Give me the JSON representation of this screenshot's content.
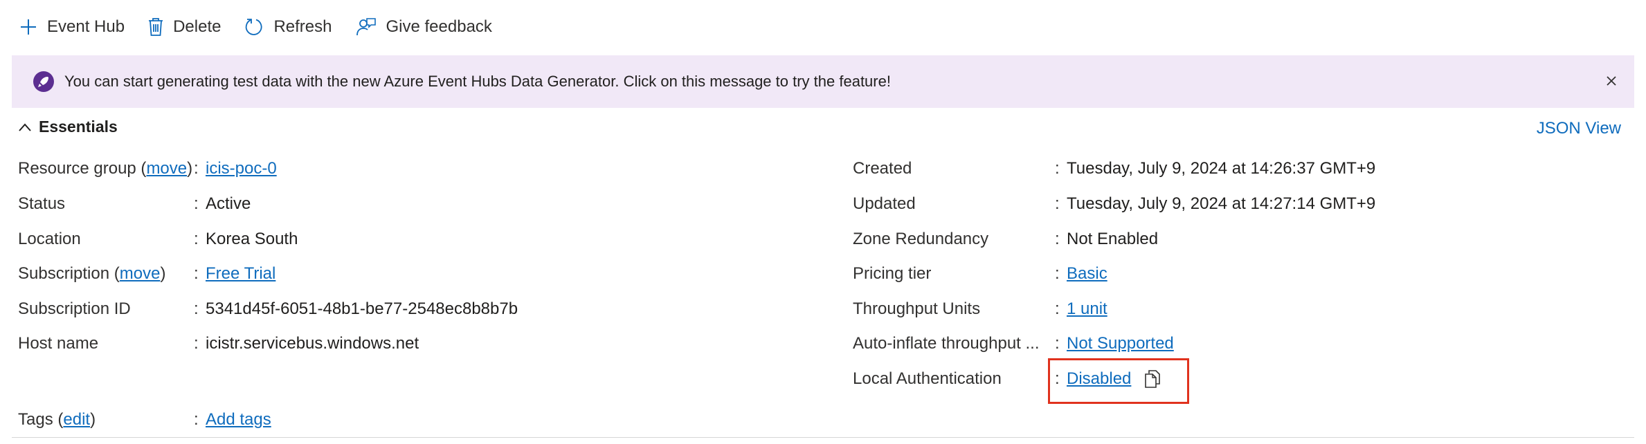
{
  "toolbar": {
    "event_hub": "Event Hub",
    "delete": "Delete",
    "refresh": "Refresh",
    "give_feedback": "Give feedback"
  },
  "banner": {
    "message": "You can start generating test data with the new Azure Event Hubs Data Generator. Click on this message to try the feature!",
    "icon": "rocket-icon",
    "close_icon": "close-icon"
  },
  "essentials": {
    "title": "Essentials",
    "json_view": "JSON View",
    "left": {
      "resource_group": {
        "label": "Resource group",
        "action": "move",
        "value": "icis-poc-0"
      },
      "status": {
        "label": "Status",
        "value": "Active"
      },
      "location": {
        "label": "Location",
        "value": "Korea South"
      },
      "subscription": {
        "label": "Subscription",
        "action": "move",
        "value": "Free Trial"
      },
      "subscription_id": {
        "label": "Subscription ID",
        "value": "5341d45f-6051-48b1-be77-2548ec8b8b7b"
      },
      "host_name": {
        "label": "Host name",
        "value": "icistr.servicebus.windows.net"
      },
      "tags": {
        "label": "Tags",
        "action": "edit",
        "value": "Add tags"
      }
    },
    "right": {
      "created": {
        "label": "Created",
        "value": "Tuesday, July 9, 2024 at 14:26:37 GMT+9"
      },
      "updated": {
        "label": "Updated",
        "value": "Tuesday, July 9, 2024 at 14:27:14 GMT+9"
      },
      "zone_redundancy": {
        "label": "Zone Redundancy",
        "value": "Not Enabled"
      },
      "pricing_tier": {
        "label": "Pricing tier",
        "value": "Basic"
      },
      "throughput_units": {
        "label": "Throughput Units",
        "value": "1 unit"
      },
      "auto_inflate": {
        "label": "Auto-inflate throughput ...",
        "value": "Not Supported"
      },
      "local_auth": {
        "label": "Local Authentication",
        "value": "Disabled"
      }
    }
  },
  "colors": {
    "link": "#0f6cbd",
    "banner_bg": "#f1e8f7",
    "banner_icon": "#5c2e91",
    "highlight": "#e0321e"
  }
}
